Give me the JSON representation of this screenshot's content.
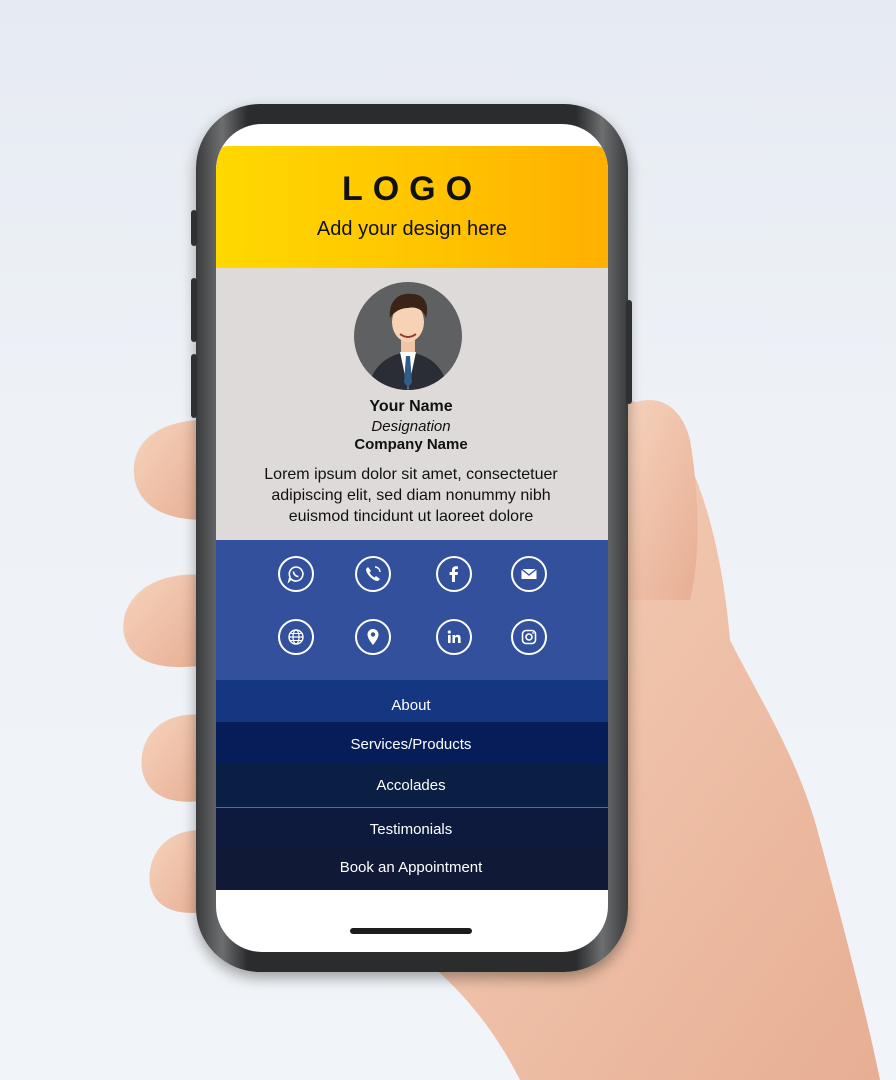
{
  "card": {
    "logo": "LOGO",
    "tagline": "Add your design here",
    "name": "Your Name",
    "designation": "Designation",
    "company": "Company Name",
    "about": "Lorem ipsum dolor sit amet, consectetuer adipiscing elit, sed diam nonummy nibh euismod tincidunt ut laoreet dolore"
  },
  "social_icons": [
    "whatsapp-icon",
    "phone-icon",
    "facebook-icon",
    "email-icon",
    "globe-icon",
    "location-pin-icon",
    "linkedin-icon",
    "instagram-icon"
  ],
  "menu": [
    "About",
    "Services/Products",
    "Accolades",
    "Testimonials",
    "Book an Appointment"
  ],
  "colors": {
    "header_gradient": [
      "#ffd800",
      "#ffb000"
    ],
    "profile_bg": "#dedad9",
    "social_bg": "#33509c",
    "menu_bg": [
      "#153681",
      "#061d5a",
      "#0b1e43",
      "#0d1a3e",
      "#101a36"
    ]
  }
}
